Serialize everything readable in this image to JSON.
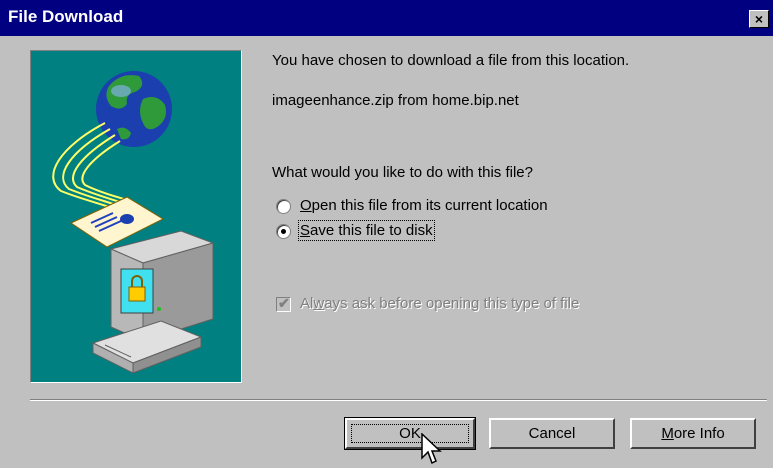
{
  "window": {
    "title": "File Download"
  },
  "titlebar": {
    "close_label": "×"
  },
  "message": {
    "intro": "You have chosen to download a file from this location.",
    "file_line": "imageenhance.zip from home.bip.net",
    "question": "What would you like to do with this file?"
  },
  "options": {
    "open": {
      "accel": "O",
      "rest": "pen this file from its current location",
      "selected": false
    },
    "save": {
      "accel": "S",
      "rest": "ave this file to disk",
      "selected": true
    }
  },
  "always_ask": {
    "pre": "Al",
    "accel": "w",
    "rest": "ays ask before opening this type of file",
    "checked": true,
    "enabled": false
  },
  "buttons": {
    "ok": "OK",
    "cancel": "Cancel",
    "more_info_accel": "M",
    "more_info_rest": "ore Info"
  },
  "colors": {
    "titlebar": "#000080",
    "panel": "#008080",
    "face": "#c0c0c0"
  },
  "icons": [
    "globe-icon",
    "document-icon",
    "computer-lock-icon",
    "mouse-cursor-icon"
  ]
}
